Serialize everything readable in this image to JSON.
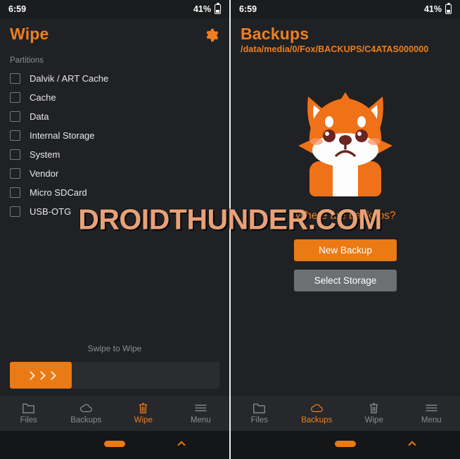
{
  "watermark": {
    "text": "DROIDTHUNDER.COM"
  },
  "colors": {
    "accent_orange": "#ef7f1f",
    "button_orange": "#ea7a13",
    "button_gray": "#6d6f72",
    "background": "#202124",
    "nav_background": "#26282b",
    "text_primary": "#e8e8e8",
    "text_muted": "#8b8d90",
    "watermark": "#e8a177"
  },
  "left_panel": {
    "status_bar": {
      "time": "6:59",
      "battery_percent": "41%",
      "battery_icon": "battery-icon"
    },
    "header": {
      "title": "Wipe",
      "settings_icon": "gear-icon"
    },
    "section_label": "Partitions",
    "partitions": [
      {
        "label": "Dalvik / ART Cache",
        "checked": false
      },
      {
        "label": "Cache",
        "checked": false
      },
      {
        "label": "Data",
        "checked": false
      },
      {
        "label": "Internal Storage",
        "checked": false
      },
      {
        "label": "System",
        "checked": false
      },
      {
        "label": "Vendor",
        "checked": false
      },
      {
        "label": "Micro SDCard",
        "checked": false
      },
      {
        "label": "USB-OTG",
        "checked": false
      }
    ],
    "swipe": {
      "label": "Swipe to Wipe",
      "thumb_icon": "chevron-right-icon"
    },
    "nav": [
      {
        "label": "Files",
        "icon": "folder-icon",
        "active": false
      },
      {
        "label": "Backups",
        "icon": "cloud-icon",
        "active": false
      },
      {
        "label": "Wipe",
        "icon": "trash-icon",
        "active": true
      },
      {
        "label": "Menu",
        "icon": "hamburger-icon",
        "active": false
      }
    ],
    "gesture_bar": {
      "home_icon": "home-pill-icon",
      "up_icon": "chevron-up-icon"
    }
  },
  "right_panel": {
    "status_bar": {
      "time": "6:59",
      "battery_percent": "41%",
      "battery_icon": "battery-icon"
    },
    "header": {
      "title": "Backups",
      "path": "/data/media/0/Fox/BACKUPS/C4ATAS000000"
    },
    "empty_state": {
      "illustration": "sad-fox-mascot",
      "message": "Where are backups?",
      "primary_button": "New Backup",
      "secondary_button": "Select Storage"
    },
    "nav": [
      {
        "label": "Files",
        "icon": "folder-icon",
        "active": false
      },
      {
        "label": "Backups",
        "icon": "cloud-icon",
        "active": true
      },
      {
        "label": "Wipe",
        "icon": "trash-icon",
        "active": false
      },
      {
        "label": "Menu",
        "icon": "hamburger-icon",
        "active": false
      }
    ],
    "gesture_bar": {
      "home_icon": "home-pill-icon",
      "up_icon": "chevron-up-icon"
    }
  }
}
